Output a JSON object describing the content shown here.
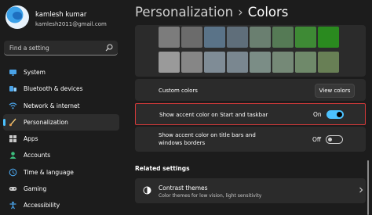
{
  "profile": {
    "name": "kamlesh kumar",
    "email": "kamlesh2011@gmail.com"
  },
  "search": {
    "placeholder": "Find a setting"
  },
  "nav": {
    "items": [
      {
        "label": "System",
        "icon": "monitor-icon"
      },
      {
        "label": "Bluetooth & devices",
        "icon": "bluetooth-icon"
      },
      {
        "label": "Network & internet",
        "icon": "wifi-icon"
      },
      {
        "label": "Personalization",
        "icon": "brush-icon",
        "active": true
      },
      {
        "label": "Apps",
        "icon": "apps-icon"
      },
      {
        "label": "Accounts",
        "icon": "person-icon"
      },
      {
        "label": "Time & language",
        "icon": "globe-icon"
      },
      {
        "label": "Gaming",
        "icon": "gamepad-icon"
      },
      {
        "label": "Accessibility",
        "icon": "accessibility-icon"
      }
    ]
  },
  "breadcrumb": {
    "parent": "Personalization",
    "separator": "›",
    "current": "Colors"
  },
  "palette": {
    "colors": [
      "#7c7c7c",
      "#6b6b6b",
      "#5a7388",
      "#5f6e7a",
      "#6a7f70",
      "#557a55",
      "#3e8a35",
      "#2a8a1f",
      "#9a9a9a",
      "#868686",
      "#7f8c96",
      "#7a8790",
      "#7b8d86",
      "#758977",
      "#6f896a",
      "#687f55"
    ]
  },
  "custom_colors": {
    "label": "Custom colors",
    "button": "View colors"
  },
  "accent_start": {
    "label": "Show accent color on Start and taskbar",
    "state": "On",
    "on": true
  },
  "accent_title": {
    "line1": "Show accent color on title bars and",
    "line2": "windows borders",
    "state": "Off",
    "on": false
  },
  "related": {
    "heading": "Related settings",
    "contrast": {
      "title": "Contrast themes",
      "desc": "Color themes for low vision, light sensitivity"
    }
  },
  "colors": {
    "accent": "#4cc2ff",
    "highlight_border": "#d63a3a",
    "panel": "#2b2b2b",
    "background": "#1c1c1c"
  }
}
